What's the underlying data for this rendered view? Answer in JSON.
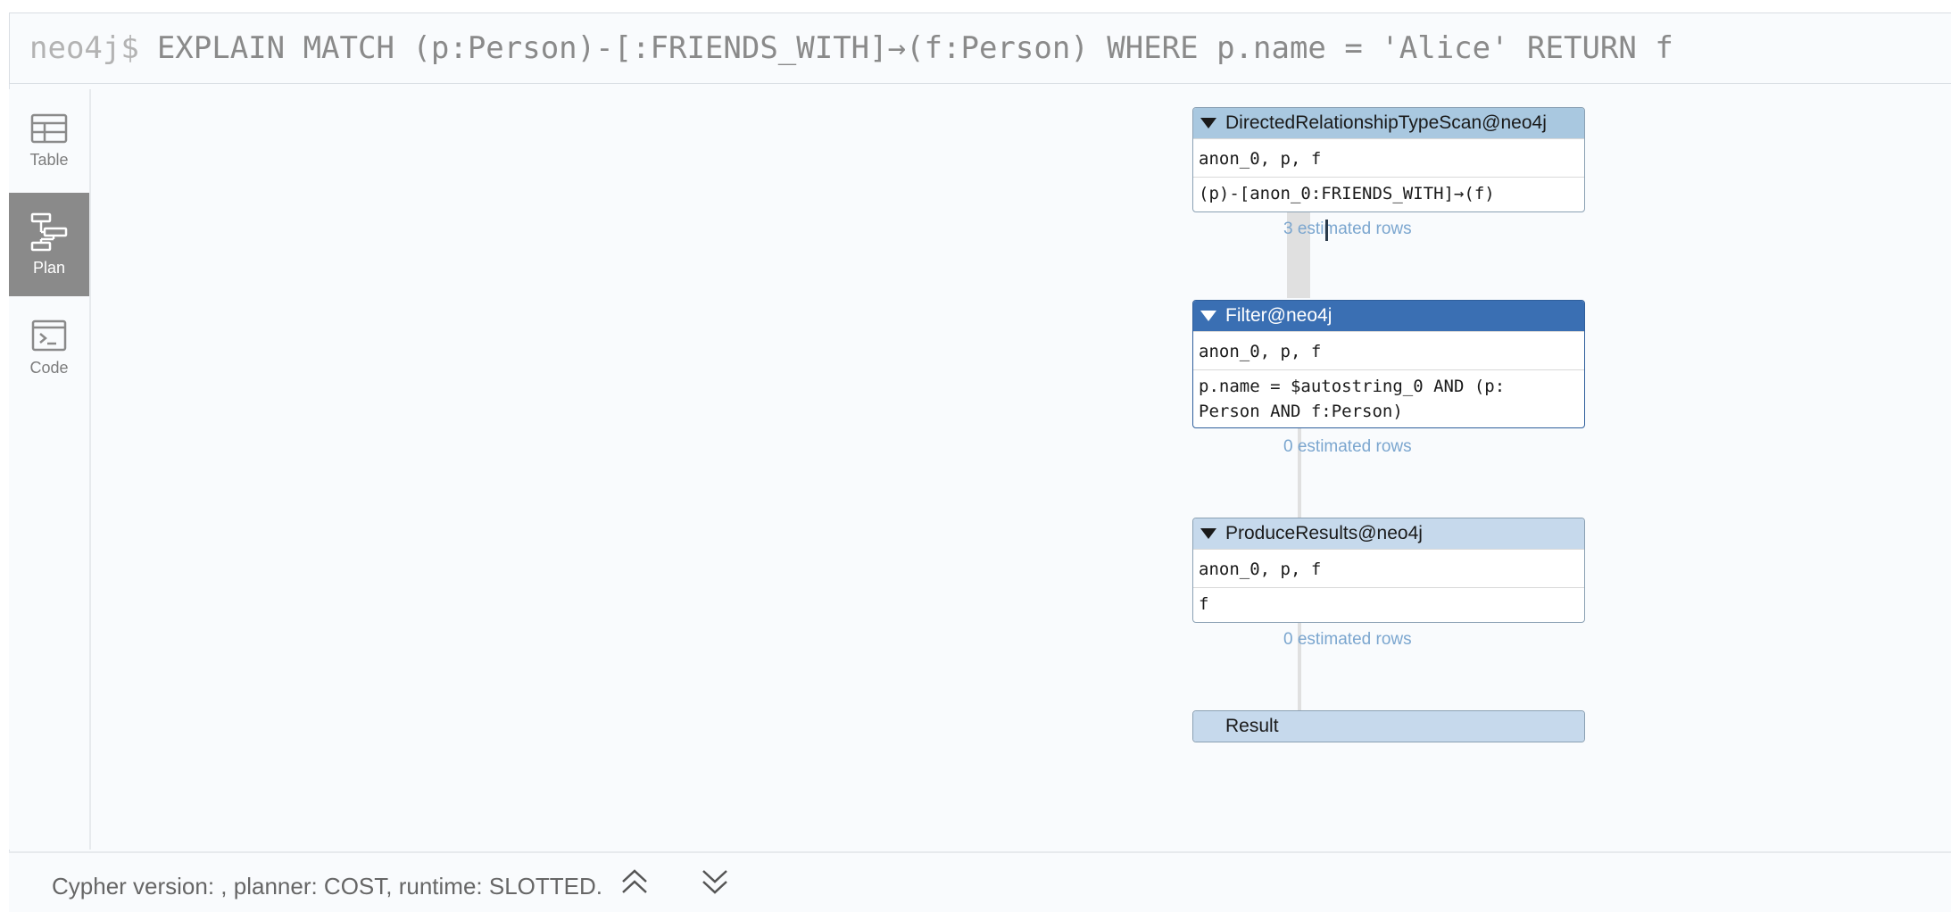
{
  "query": {
    "prompt": "neo4j$",
    "text": "EXPLAIN MATCH (p:Person)-[:FRIENDS_WITH]→(f:Person) WHERE p.name = 'Alice' RETURN f"
  },
  "sidebar": {
    "items": [
      {
        "label": "Table",
        "icon": "table-icon",
        "active": false
      },
      {
        "label": "Plan",
        "icon": "plan-icon",
        "active": true
      },
      {
        "label": "Code",
        "icon": "code-icon",
        "active": false
      }
    ]
  },
  "plan": {
    "operators": [
      {
        "title": "DirectedRelationshipTypeScan@neo4j",
        "variables": "anon_0, p, f",
        "details": "(p)-[anon_0:FRIENDS_WITH]→(f)",
        "estimate": "3 estimated rows"
      },
      {
        "title": "Filter@neo4j",
        "variables": "anon_0, p, f",
        "details_line1": "p.name = $autostring_0 AND (p:",
        "details_line2": "Person AND f:Person)",
        "estimate": "0 estimated rows"
      },
      {
        "title": "ProduceResults@neo4j",
        "variables": "anon_0, p, f",
        "details": "f",
        "estimate": "0 estimated rows"
      },
      {
        "title": "Result"
      }
    ]
  },
  "footer": {
    "info": "Cypher version: , planner: COST, runtime: SLOTTED."
  },
  "colors": {
    "active_sidebar": "#8a8a8a",
    "filter_header": "#3a6fb3",
    "scan_header": "#a9c8e0",
    "estimate_text": "#7ba6cf"
  }
}
